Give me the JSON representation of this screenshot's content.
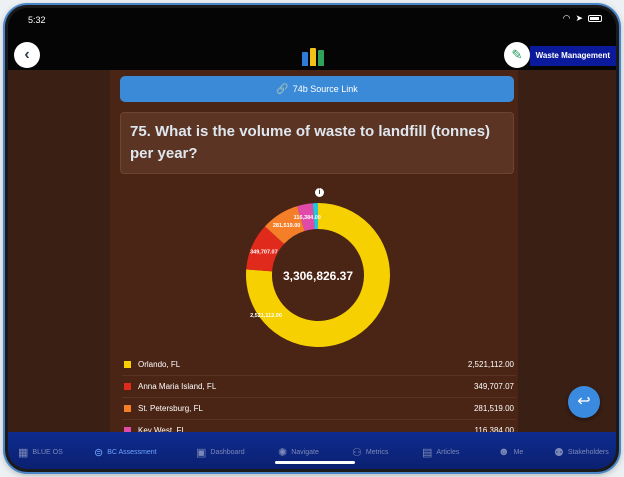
{
  "status": {
    "time": "5:32"
  },
  "header": {
    "section": "Waste Management",
    "logo_icon": "recycling-bins-icon"
  },
  "source_link": {
    "label": "74b Source Link"
  },
  "question": {
    "text": "75. What is the volume of waste to landfill (tonnes) per year?"
  },
  "chart_data": {
    "type": "pie",
    "total": "3,306,826.37",
    "slices": [
      {
        "name": "Orlando, FL",
        "value": 2521112.0,
        "label": "2,521,112.00",
        "color": "#f6d000"
      },
      {
        "name": "Anna Maria Island, FL",
        "value": 349707.07,
        "label": "349,707.07",
        "color": "#e02a1c"
      },
      {
        "name": "St. Petersburg, FL",
        "value": 281519.0,
        "label": "281,519.00",
        "color": "#f57f29"
      },
      {
        "name": "Key West, FL",
        "value": 116384.0,
        "label": "116,384.00",
        "color": "#e04aa8"
      },
      {
        "name": "",
        "value": 38104.3,
        "label": "",
        "color": "#22c6d8"
      }
    ]
  },
  "legend": [
    {
      "name": "Orlando, FL",
      "value": "2,521,112.00",
      "color": "#f6d000"
    },
    {
      "name": "Anna Maria Island, FL",
      "value": "349,707.07",
      "color": "#e02a1c"
    },
    {
      "name": "St. Petersburg, FL",
      "value": "281,519.00",
      "color": "#f57f29"
    },
    {
      "name": "Key West, FL",
      "value": "116,384.00",
      "color": "#e04aa8"
    }
  ],
  "tabs": [
    {
      "label": "BLUE OS",
      "icon": "grid-icon",
      "active": false
    },
    {
      "label": "BC Assessment",
      "icon": "assessment-icon",
      "active": true
    },
    {
      "label": "Dashboard",
      "icon": "dashboard-icon",
      "active": false
    },
    {
      "label": "Navigate",
      "icon": "compass-icon",
      "active": false
    },
    {
      "label": "Metrics",
      "icon": "metrics-icon",
      "active": false
    },
    {
      "label": "Articles",
      "icon": "articles-icon",
      "active": false
    },
    {
      "label": "Me",
      "icon": "profile-icon",
      "active": false
    },
    {
      "label": "Stakeholders",
      "icon": "stakeholders-icon",
      "active": false
    }
  ]
}
